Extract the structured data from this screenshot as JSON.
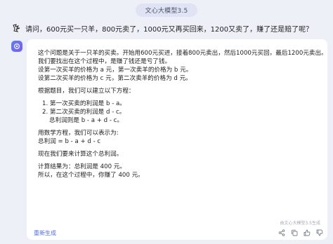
{
  "header": {
    "model_label": "文心大模型3.5"
  },
  "user": {
    "question": "请问，600元买一只羊，800元卖了，1000元又再买回来，1200又卖了，赚了还是赔了呢？"
  },
  "answer": {
    "lines": [
      "这个问题是关于一只羊的买卖。开始用600元买进，接着800元卖出，然后1000元买回，最后1200元卖出。",
      "我们要找出在这个过程中，是赚了钱还是亏了钱。",
      "设第一次买羊的价格为 a 元，第一次卖羊的价格为 b 元。",
      "设第二次买羊的价格为 c 元，第二次卖羊的价格为 d 元。",
      "根据题目，我们可以建立以下方程：",
      "1. 第一次买卖的利润是 b - a。",
      "2. 第二次买卖的利润是 d - c。",
      "总利润则是 b - a + d - c。",
      "用数学方程，我们可以表示为:",
      "总利润 = b - a + d - c",
      "现在我们要来计算这个总利润。",
      "计算结果为：总利润是 400 元。",
      "所以，在这个过程中，你赚了 400 元。"
    ],
    "watermark": "由文心大模型3.5生成"
  },
  "footer": {
    "regenerate_label": "重新生成",
    "icons": [
      "share-icon",
      "copy-icon",
      "thumbs-up-icon",
      "thumbs-down-icon"
    ]
  },
  "colors": {
    "accent": "#4d6bfe",
    "background": "#eef0f7",
    "card": "#ffffff"
  }
}
